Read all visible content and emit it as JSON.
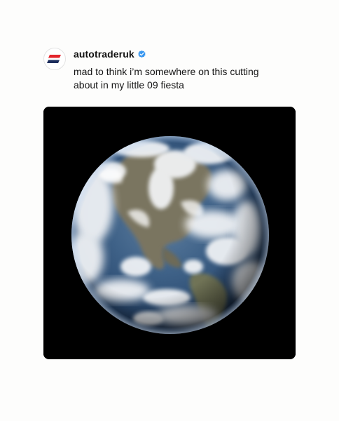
{
  "post": {
    "username": "autotraderuk",
    "verified": true,
    "caption": "mad to think i’m somewhere on this cutting about in my little 09 fiesta",
    "avatar_icon": "autotrader-logo-icon",
    "verified_icon": "verified-badge-icon",
    "image_subject": "earth-photo"
  },
  "colors": {
    "brand_red": "#e3242b",
    "brand_navy": "#1b2c5b",
    "verified_blue": "#3897f0",
    "photo_background": "#000000"
  }
}
